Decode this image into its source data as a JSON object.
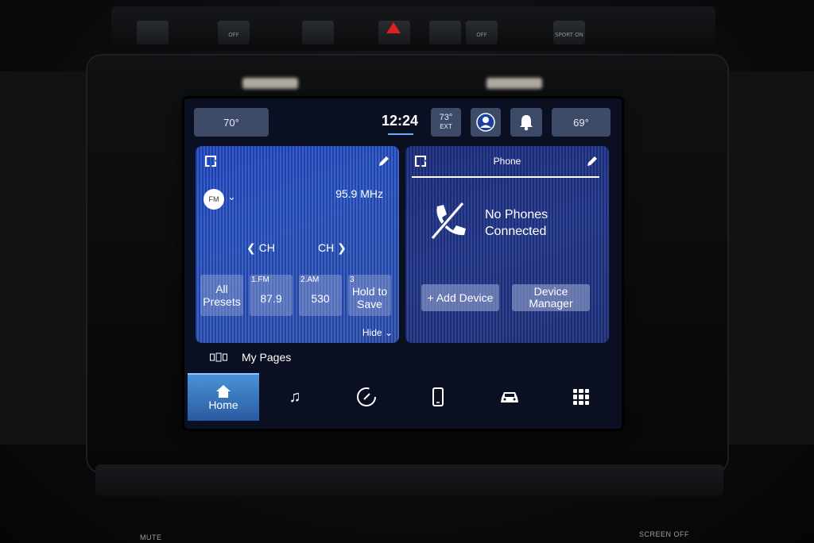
{
  "hardware": {
    "button_labels": [
      "",
      "OFF",
      "",
      "",
      "",
      "OFF",
      "SPORT ON"
    ],
    "bottom_left": "MUTE",
    "bottom_right": "SCREEN OFF"
  },
  "status": {
    "left_temp": "70°",
    "clock": "12:24",
    "ext_temp": "73°",
    "ext_label": "EXT",
    "right_temp": "69°"
  },
  "radio": {
    "band": "FM",
    "frequency": "95.9 MHz",
    "ch_prev": "CH",
    "ch_next": "CH",
    "presets": [
      {
        "num": "",
        "label": "All Presets"
      },
      {
        "num": "1.FM",
        "label": "87.9"
      },
      {
        "num": "2.AM",
        "label": "530"
      },
      {
        "num": "3",
        "label": "Hold to Save"
      }
    ],
    "hide_label": "Hide"
  },
  "phone": {
    "title": "Phone",
    "message_line1": "No Phones",
    "message_line2": "Connected",
    "add_device": "+ Add Device",
    "device_manager": "Device Manager"
  },
  "my_pages": "My Pages",
  "nav": {
    "items": [
      {
        "icon": "home-icon",
        "label": "Home",
        "active": true
      },
      {
        "icon": "music-icon",
        "label": ""
      },
      {
        "icon": "gauge-icon",
        "label": ""
      },
      {
        "icon": "phone-icon",
        "label": ""
      },
      {
        "icon": "car-icon",
        "label": ""
      },
      {
        "icon": "apps-grid-icon",
        "label": ""
      }
    ]
  },
  "colors": {
    "screen_bg": "#0a1022",
    "radio_panel": "#3564c4",
    "phone_panel": "#2b3f8a",
    "active_nav": "#4a92d8",
    "hazard": "#e02020"
  }
}
